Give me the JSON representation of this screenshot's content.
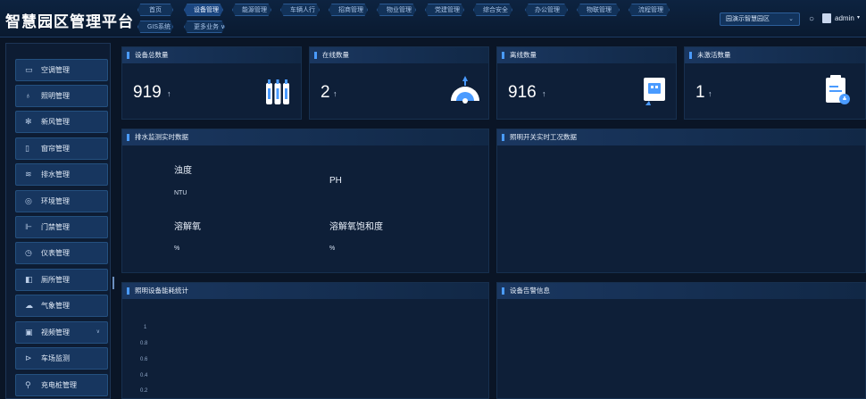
{
  "header": {
    "title": "智慧园区管理平台",
    "nav": [
      "首页",
      "设备管理",
      "能源管理",
      "车辆人行",
      "招商管理",
      "物业管理",
      "党建管理",
      "综合安全",
      "办公管理",
      "物联管理",
      "流程管理",
      "GIS系统",
      "更多业务 ∨"
    ],
    "park_select": "园演示智慧园区",
    "user": "admin"
  },
  "sidebar": {
    "items": [
      {
        "label": "空调管理",
        "icon": "air-conditioner-icon"
      },
      {
        "label": "照明管理",
        "icon": "lightbulb-icon"
      },
      {
        "label": "新风管理",
        "icon": "fan-icon"
      },
      {
        "label": "窗帘管理",
        "icon": "curtain-icon"
      },
      {
        "label": "排水管理",
        "icon": "drainage-icon"
      },
      {
        "label": "环境管理",
        "icon": "environment-icon"
      },
      {
        "label": "门禁管理",
        "icon": "door-icon"
      },
      {
        "label": "仪表管理",
        "icon": "meter-icon"
      },
      {
        "label": "厕所管理",
        "icon": "restroom-icon"
      },
      {
        "label": "气象管理",
        "icon": "weather-icon"
      },
      {
        "label": "视频管理",
        "icon": "video-icon"
      },
      {
        "label": "车场监测",
        "icon": "parking-icon"
      },
      {
        "label": "充电桩管理",
        "icon": "charging-icon"
      }
    ]
  },
  "stats": [
    {
      "title": "设备总数量",
      "value": "919",
      "trend": "↑",
      "icon": "devices-icon"
    },
    {
      "title": "在线数量",
      "value": "2",
      "trend": "↑",
      "icon": "online-gauge-icon"
    },
    {
      "title": "离线数量",
      "value": "916",
      "trend": "↑",
      "icon": "offline-device-icon"
    },
    {
      "title": "未激活数量",
      "value": "1",
      "trend": "↑",
      "icon": "inactive-device-icon"
    }
  ],
  "drain": {
    "title": "排水监测实时数据",
    "metrics": [
      {
        "label": "浊度",
        "unit": "NTU"
      },
      {
        "label": "PH",
        "unit": ""
      },
      {
        "label": "溶解氧",
        "unit": "%"
      },
      {
        "label": "溶解氧饱和度",
        "unit": "%"
      }
    ]
  },
  "lighting_switch": {
    "title": "照明开关实时工况数据"
  },
  "lighting_energy": {
    "title": "照明设备能耗统计",
    "y_ticks": [
      "1",
      "0.8",
      "0.6",
      "0.4",
      "0.2"
    ]
  },
  "alarm": {
    "title": "设备告警信息"
  },
  "colors": {
    "background": "#0a1526",
    "card": "#0e1f38",
    "accent": "#4a9bff",
    "sidebar_item": "#17365f"
  }
}
